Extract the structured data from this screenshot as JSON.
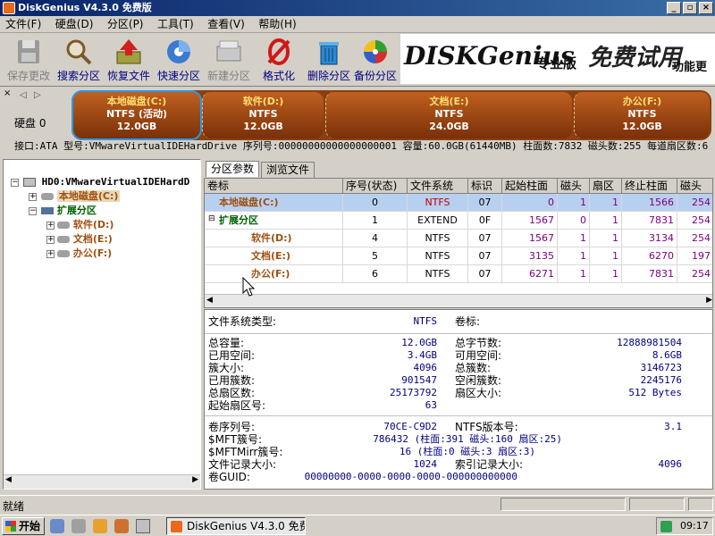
{
  "window": {
    "title": "DiskGenius V4.3.0 免费版"
  },
  "menu": [
    "文件(F)",
    "硬盘(D)",
    "分区(P)",
    "工具(T)",
    "查看(V)",
    "帮助(H)"
  ],
  "toolbar": [
    {
      "label": "保存更改",
      "icon": "save-disk-icon",
      "enabled": false
    },
    {
      "label": "搜索分区",
      "icon": "magnifier-icon",
      "enabled": true
    },
    {
      "label": "恢复文件",
      "icon": "recover-files-icon",
      "enabled": true
    },
    {
      "label": "快速分区",
      "icon": "quick-partition-icon",
      "enabled": true
    },
    {
      "label": "新建分区",
      "icon": "new-partition-icon",
      "enabled": false
    },
    {
      "label": "格式化",
      "icon": "format-icon",
      "enabled": true
    },
    {
      "label": "删除分区",
      "icon": "trash-icon",
      "enabled": true
    },
    {
      "label": "备份分区",
      "icon": "backup-icon",
      "enabled": true
    }
  ],
  "banner": {
    "logo": "DISKGenius",
    "edition": "专业版",
    "promo": "免费试用",
    "more": "功能更"
  },
  "diskbar": {
    "disk_label": "硬盘 0",
    "partitions": [
      {
        "name": "本地磁盘(C:)",
        "fs": "NTFS (活动)",
        "size": "12.0GB"
      },
      {
        "name": "软件(D:)",
        "fs": "NTFS",
        "size": "12.0GB"
      },
      {
        "name": "文档(E:)",
        "fs": "NTFS",
        "size": "24.0GB"
      },
      {
        "name": "办公(F:)",
        "fs": "NTFS",
        "size": "12.0GB"
      }
    ]
  },
  "infostrip": "接口:ATA  型号:VMwareVirtualIDEHardDrive  序列号:00000000000000000001  容量:60.0GB(61440MB)  柱面数:7832  磁头数:255  每道扇区数:6",
  "tree": {
    "root": "HD0:VMwareVirtualIDEHardD",
    "c": "本地磁盘(C:)",
    "ext": "扩展分区",
    "d": "软件(D:)",
    "e": "文档(E:)",
    "f": "办公(F:)"
  },
  "tabs": [
    "分区参数",
    "浏览文件"
  ],
  "grid": {
    "headers": [
      "卷标",
      "序号(状态)",
      "文件系统",
      "标识",
      "起始柱面",
      "磁头",
      "扇区",
      "终止柱面",
      "磁头"
    ],
    "rows": [
      {
        "label": "本地磁盘(C:)",
        "idx": "0",
        "fs": "NTFS",
        "id": "07",
        "sc": "0",
        "sh": "1",
        "ss": "1",
        "ec": "1566",
        "eh": "254"
      },
      {
        "label": "扩展分区",
        "idx": "1",
        "fs": "EXTEND",
        "id": "0F",
        "sc": "1567",
        "sh": "0",
        "ss": "1",
        "ec": "7831",
        "eh": "254"
      },
      {
        "label": "软件(D:)",
        "idx": "4",
        "fs": "NTFS",
        "id": "07",
        "sc": "1567",
        "sh": "1",
        "ss": "1",
        "ec": "3134",
        "eh": "254"
      },
      {
        "label": "文档(E:)",
        "idx": "5",
        "fs": "NTFS",
        "id": "07",
        "sc": "3135",
        "sh": "1",
        "ss": "1",
        "ec": "6270",
        "eh": "197"
      },
      {
        "label": "办公(F:)",
        "idx": "6",
        "fs": "NTFS",
        "id": "07",
        "sc": "6271",
        "sh": "1",
        "ss": "1",
        "ec": "7831",
        "eh": "254"
      }
    ]
  },
  "details": {
    "fs_type_label": "文件系统类型:",
    "fs_type": "NTFS",
    "vol_label": "卷标:",
    "l1": [
      "总容量:",
      "已用空间:",
      "簇大小:",
      "已用簇数:",
      "总扇区数:",
      "起始扇区号:"
    ],
    "v1": [
      "12.0GB",
      "3.4GB",
      "4096",
      "901547",
      "25173792",
      "63"
    ],
    "l2": [
      "总字节数:",
      "可用空间:",
      "总簇数:",
      "空闲簇数:",
      "扇区大小:"
    ],
    "v2": [
      "12888981504",
      "8.6GB",
      "3146723",
      "2245176",
      "512 Bytes"
    ],
    "serial_label": "卷序列号:",
    "serial": "70CE-C9D2",
    "ntfsver_label": "NTFS版本号:",
    "ntfsver": "3.1",
    "mft_label": "$MFT簇号:",
    "mft": "786432 (柱面:391 磁头:160 扇区:25)",
    "mftmirr_label": "$MFTMirr簇号:",
    "mftmirr": "16 (柱面:0 磁头:3 扇区:3)",
    "frs_label": "文件记录大小:",
    "frs": "1024",
    "irs_label": "索引记录大小:",
    "irs": "4096",
    "guid_label": "卷GUID:",
    "guid": "00000000-0000-0000-0000-000000000000"
  },
  "status": {
    "text": "就绪"
  },
  "taskbar": {
    "start": "开始",
    "task": "DiskGenius V4.3.0 免费版",
    "clock": "09:17"
  }
}
